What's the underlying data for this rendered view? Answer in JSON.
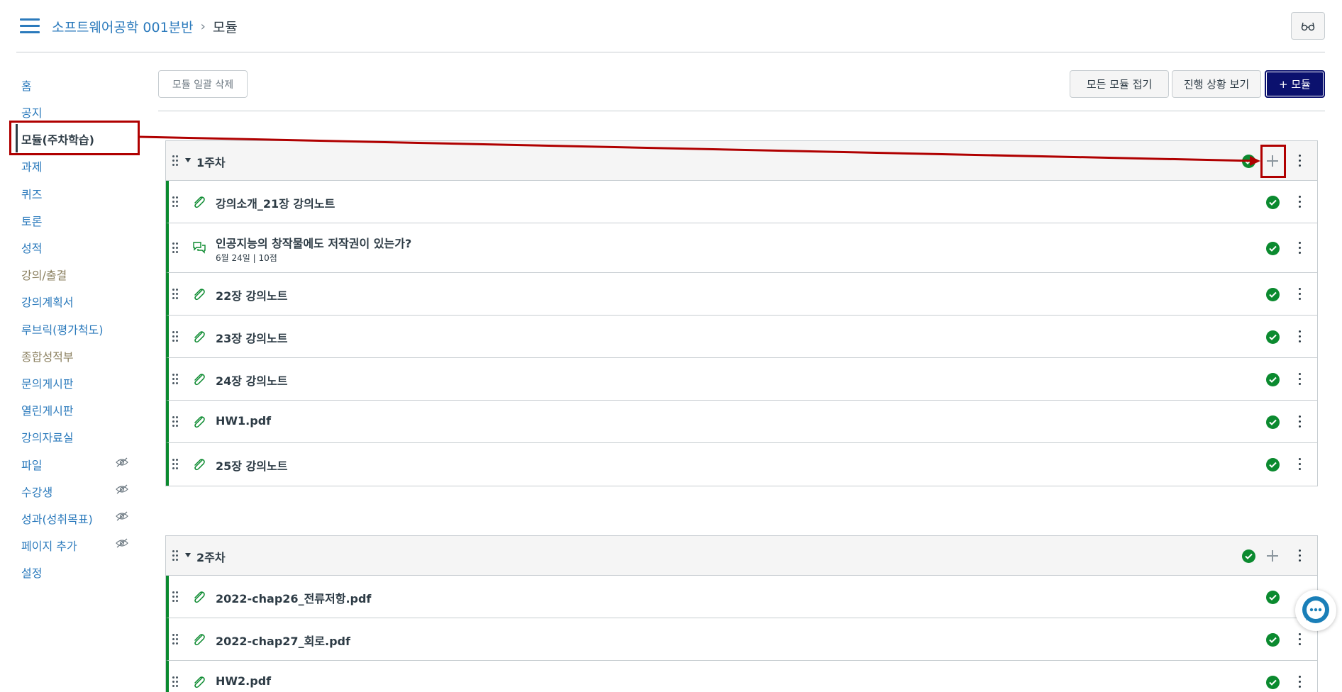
{
  "header": {
    "course_link": "소프트웨어공학 001분반",
    "separator": "›",
    "current_page": "모듈"
  },
  "sidebar": {
    "items": [
      {
        "label": "홈"
      },
      {
        "label": "공지"
      },
      {
        "label": "모듈(주차학습)"
      },
      {
        "label": "과제"
      },
      {
        "label": "퀴즈"
      },
      {
        "label": "토론"
      },
      {
        "label": "성적"
      },
      {
        "label": "강의/출결"
      },
      {
        "label": "강의계획서"
      },
      {
        "label": "루브릭(평가척도)"
      },
      {
        "label": "종합성적부"
      },
      {
        "label": "문의게시판"
      },
      {
        "label": "열린게시판"
      },
      {
        "label": "강의자료실"
      },
      {
        "label": "파일"
      },
      {
        "label": "수강생"
      },
      {
        "label": "성과(성취목표)"
      },
      {
        "label": "페이지 추가"
      },
      {
        "label": "설정"
      }
    ]
  },
  "toolbar": {
    "bulk_delete": "모듈 일괄 삭제",
    "collapse_all": "모든 모듈 접기",
    "view_progress": "진행 상황 보기",
    "add_module": "+ 모듈"
  },
  "modules": [
    {
      "title": "1주차",
      "items": [
        {
          "title": "강의소개_21장 강의노트",
          "type": "attachment"
        },
        {
          "title": "인공지능의 창작물에도 저작권이 있는가?",
          "type": "discussion",
          "meta": "6월 24일  |  10점"
        },
        {
          "title": "22장 강의노트",
          "type": "attachment"
        },
        {
          "title": "23장 강의노트",
          "type": "attachment"
        },
        {
          "title": "24장 강의노트",
          "type": "attachment"
        },
        {
          "title": "HW1.pdf",
          "type": "attachment"
        },
        {
          "title": "25장 강의노트",
          "type": "attachment"
        }
      ]
    },
    {
      "title": "2주차",
      "items": [
        {
          "title": "2022-chap26_전류저항.pdf",
          "type": "attachment"
        },
        {
          "title": "2022-chap27_회로.pdf",
          "type": "attachment"
        },
        {
          "title": "HW2.pdf",
          "type": "attachment"
        }
      ]
    }
  ],
  "colors": {
    "link": "#2b7abc",
    "published": "#0b8a2f",
    "primary_button": "#0b116e",
    "annotation": "#b00000"
  }
}
